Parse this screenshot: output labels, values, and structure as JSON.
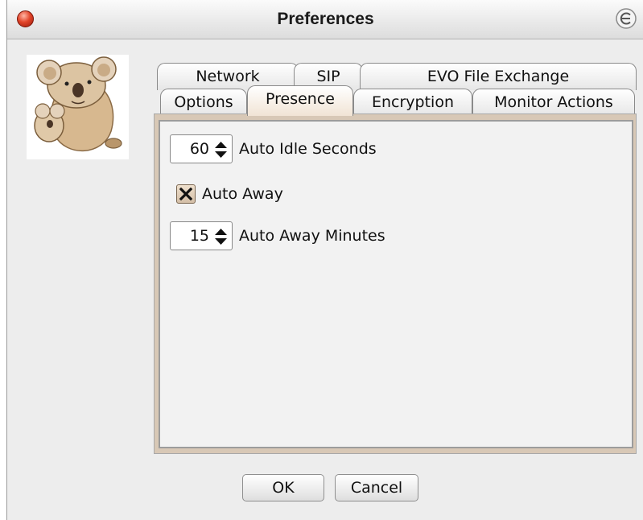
{
  "window": {
    "title": "Preferences"
  },
  "tabs": {
    "row_back": [
      {
        "label": "Network"
      },
      {
        "label": "SIP"
      },
      {
        "label": "EVO File Exchange"
      }
    ],
    "row_front": [
      {
        "label": "Options"
      },
      {
        "label": "Presence",
        "selected": true
      },
      {
        "label": "Encryption"
      },
      {
        "label": "Monitor Actions"
      }
    ]
  },
  "presence": {
    "auto_idle": {
      "value": "60",
      "label": "Auto Idle Seconds"
    },
    "auto_away": {
      "checked": true,
      "label": "Auto Away"
    },
    "auto_away_minutes": {
      "value": "15",
      "label": "Auto Away Minutes"
    }
  },
  "buttons": {
    "ok": "OK",
    "cancel": "Cancel"
  },
  "colors": {
    "close_button": "#e2452a",
    "selected_tab": "#f1e4d5",
    "checkbox": "#d4bfa7"
  }
}
